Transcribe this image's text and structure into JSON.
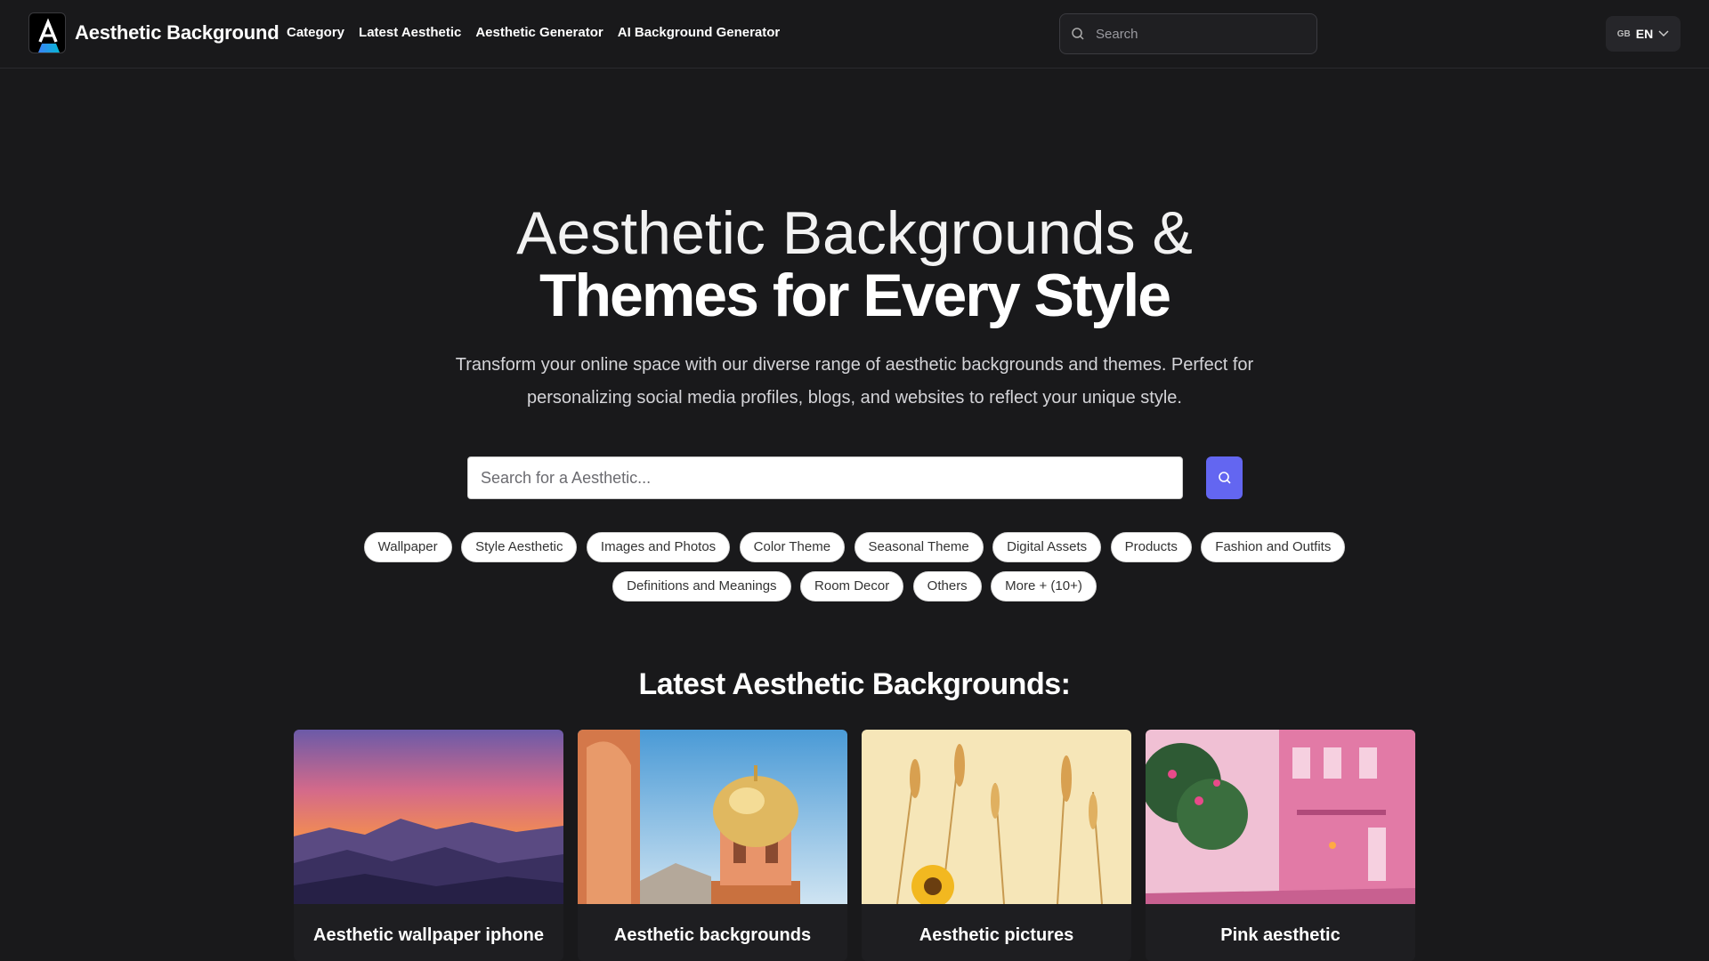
{
  "header": {
    "logo_text": "Aesthetic Background",
    "nav": [
      "Category",
      "Latest Aesthetic",
      "Aesthetic Generator",
      "AI Background Generator"
    ],
    "search_placeholder": "Search",
    "lang_flag": "GB",
    "lang_label": "EN"
  },
  "hero": {
    "title_line1": "Aesthetic Backgrounds &",
    "title_line2": "Themes for Every Style",
    "description": "Transform your online space with our diverse range of aesthetic backgrounds and themes. Perfect for personalizing social media profiles, blogs, and websites to reflect your unique style.",
    "search_placeholder": "Search for a Aesthetic..."
  },
  "categories_row1": [
    "Wallpaper",
    "Style Aesthetic",
    "Images and Photos",
    "Color Theme",
    "Seasonal Theme",
    "Digital Assets",
    "Products",
    "Fashion and Outfits"
  ],
  "categories_row2": [
    "Definitions and Meanings",
    "Room Decor",
    "Others",
    "More + (10+)"
  ],
  "latest": {
    "title": "Latest Aesthetic Backgrounds:",
    "cards": [
      {
        "title": "Aesthetic wallpaper iphone",
        "image": "sunset-mountains"
      },
      {
        "title": "Aesthetic backgrounds",
        "image": "golden-dome-palace"
      },
      {
        "title": "Aesthetic pictures",
        "image": "wheat-sunflower"
      },
      {
        "title": "Pink aesthetic",
        "image": "pink-street"
      }
    ]
  },
  "colors": {
    "accent": "#6366f1",
    "background": "#19191b"
  }
}
